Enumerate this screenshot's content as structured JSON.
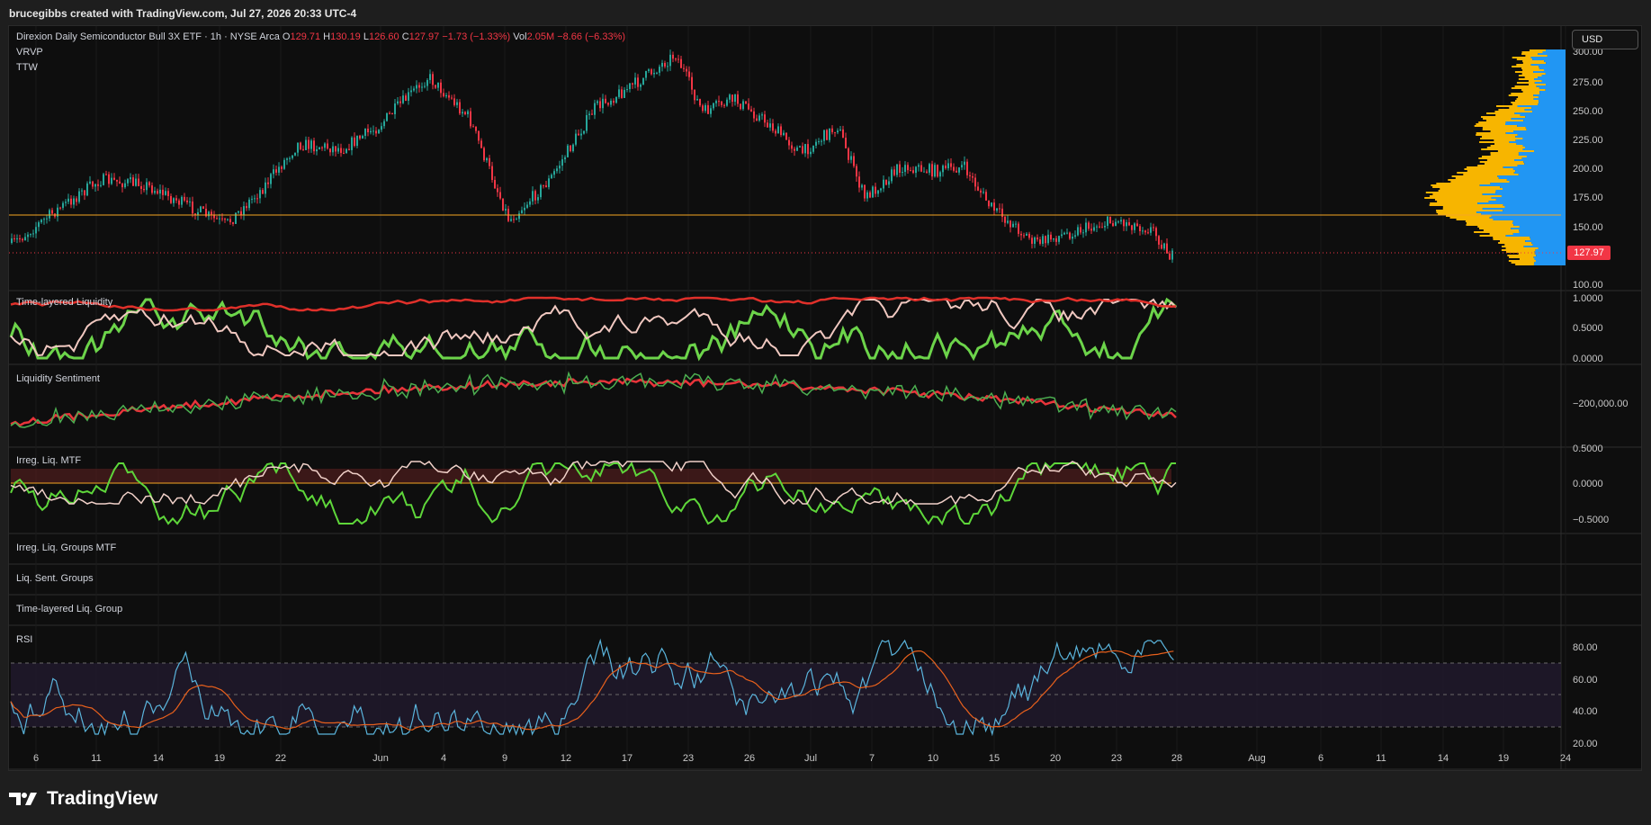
{
  "header": {
    "attribution": "brucegibbs created with TradingView.com, Jul 27, 2026 20:33 UTC-4"
  },
  "symbol": {
    "name": "Direxion Daily Semiconductor Bull 3X ETF · 1h · NYSE Arca",
    "o_label": "O",
    "o": "129.71",
    "h_label": "H",
    "h": "130.19",
    "l_label": "L",
    "l": "126.60",
    "c_label": "C",
    "c": "127.97",
    "change": "−1.73 (−1.33%)",
    "vol_label": "Vol",
    "vol": "2.05M",
    "vol_change": "−8.66 (−6.33%)"
  },
  "overlays": [
    "VRVP",
    "TTW"
  ],
  "currency_button": "USD",
  "last_price_tag": "127.97",
  "price_axis": [
    "300.00",
    "275.00",
    "250.00",
    "225.00",
    "200.00",
    "175.00",
    "150.00",
    "100.00"
  ],
  "panes": {
    "time_layered": {
      "title": "Time-layered Liquidity",
      "axis": [
        "1.0000",
        "0.5000",
        "0.0000"
      ]
    },
    "liq_sentiment": {
      "title": "Liquidity Sentiment",
      "axis": [
        "−200,000.00"
      ]
    },
    "irreg": {
      "title": "Irreg. Liq. MTF",
      "axis": [
        "0.5000",
        "0.0000",
        "−0.5000"
      ]
    },
    "irreg_groups": {
      "title": "Irreg. Liq. Groups MTF"
    },
    "sent_groups": {
      "title": "Liq. Sent. Groups"
    },
    "tl_group": {
      "title": "Time-layered Liq. Group"
    },
    "rsi": {
      "title": "RSI",
      "axis": [
        "80.00",
        "60.00",
        "40.00",
        "20.00"
      ]
    }
  },
  "time_axis": [
    "6",
    "11",
    "14",
    "19",
    "22",
    "Jun",
    "4",
    "9",
    "12",
    "17",
    "23",
    "26",
    "Jul",
    "7",
    "10",
    "15",
    "20",
    "23",
    "28",
    "Aug",
    "6",
    "11",
    "14",
    "19",
    "24"
  ],
  "colors": {
    "up": "#26a69a",
    "down": "#f23645",
    "accent": "#f5a623",
    "rsi": "#5ab4dc",
    "rsi_ma": "#e8601c"
  },
  "branding": {
    "logo": "TradingView"
  }
}
